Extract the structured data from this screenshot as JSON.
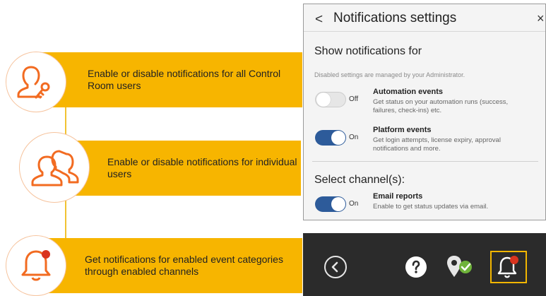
{
  "callouts": [
    {
      "text": "Enable or disable notifications for all Control Room users",
      "icon": "user-key-icon"
    },
    {
      "text": "Enable or disable notifications for individual users",
      "icon": "users-icon"
    },
    {
      "text": "Get notifications for enabled event categories through enabled channels",
      "icon": "bell-with-dot-icon"
    }
  ],
  "panel": {
    "back_glyph": "<",
    "title": "Notifications settings",
    "close_glyph": "×",
    "show_for_title": "Show notifications for",
    "admin_note": "Disabled settings are managed by your Administrator.",
    "settings": [
      {
        "state": "Off",
        "title": "Automation events",
        "desc": "Get status on your automation runs (success, failures, check-ins) etc."
      },
      {
        "state": "On",
        "title": "Platform events",
        "desc": "Get login attempts, license expiry, approval notifications and more."
      }
    ],
    "channel_title": "Select channel(s):",
    "channel": {
      "state": "On",
      "title": "Email reports",
      "desc": "Enable to get status updates via email."
    }
  },
  "toolbar": {
    "items": [
      "back-circle-icon",
      "help-icon",
      "location-check-icon",
      "bell-notification-icon"
    ]
  },
  "colors": {
    "accent_bar": "#f7b500",
    "icon_orange": "#f26b21",
    "toggle_on": "#2d5b9a",
    "toolbar_bg": "#2b2b2b",
    "highlight_frame": "#f2b600",
    "badge_red": "#d9341e",
    "check_green": "#6fb33a"
  }
}
